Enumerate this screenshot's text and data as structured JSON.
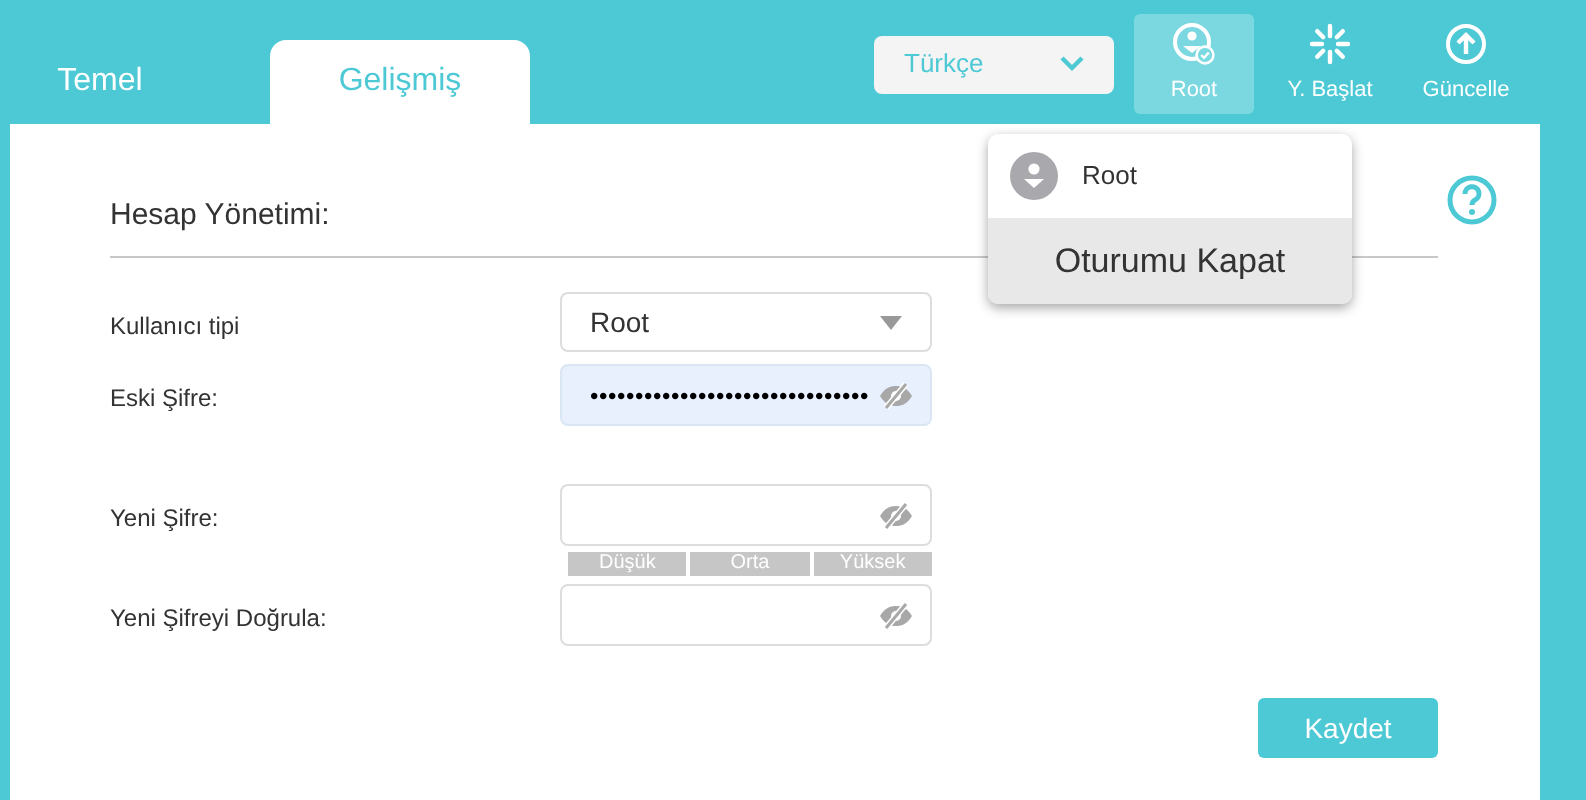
{
  "tabs": [
    {
      "label": "Temel",
      "selected": false
    },
    {
      "label": "Gelişmiş",
      "selected": true
    }
  ],
  "language": {
    "value": "Türkçe"
  },
  "toolbar": [
    {
      "label": "Root",
      "kind": "user",
      "selected": true
    },
    {
      "label": "Y. Başlat",
      "kind": "reboot",
      "selected": false
    },
    {
      "label": "Güncelle",
      "kind": "update",
      "selected": false
    }
  ],
  "user_menu": {
    "user": "Root",
    "items": [
      "Oturumu Kapat"
    ]
  },
  "section": {
    "title": "Hesap Yönetimi:"
  },
  "form": [
    {
      "label": "Kullanıcı tipi",
      "kind": "select",
      "value": "Root"
    },
    {
      "label": "Eski Şifre:",
      "kind": "password",
      "value": "•••••••••••••••••••••••••••••••",
      "filled": true
    },
    {
      "label": "Yeni Şifre:",
      "kind": "password",
      "filled": false,
      "strength": [
        "Düşük",
        "Orta",
        "Yüksek"
      ]
    },
    {
      "label": "Yeni Şifreyi Doğrula:",
      "kind": "password",
      "filled": false
    }
  ],
  "save_button": "Kaydet"
}
